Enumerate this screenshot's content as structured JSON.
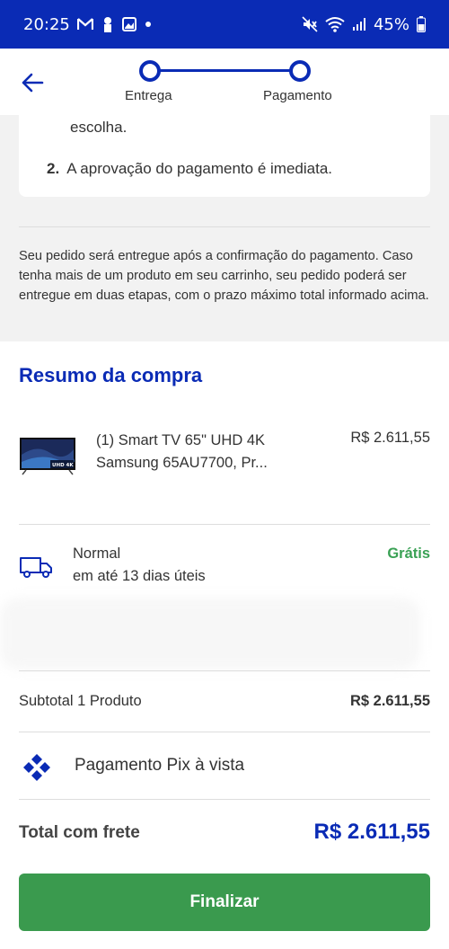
{
  "status_bar": {
    "time": "20:25",
    "battery": "45%",
    "icons": [
      "gmail-icon",
      "person-pin-icon",
      "gallery-icon",
      "dot-icon",
      "mute-icon",
      "wifi-icon",
      "signal-icon",
      "battery-icon"
    ]
  },
  "header": {
    "steps": [
      {
        "label": "Entrega"
      },
      {
        "label": "Pagamento"
      }
    ],
    "accent": "#0a2bb5"
  },
  "payment_steps": {
    "step1_tail": "escolha.",
    "step2_number": "2.",
    "step2_text": "A aprovação do pagamento é imediata."
  },
  "notice": "Seu pedido será entregue após a confirmação do pagamento. Caso tenha mais de um produto em seu carrinho, seu pedido poderá ser entregue em duas etapas, com o prazo máximo total informado acima.",
  "summary": {
    "title": "Resumo da compra",
    "product": {
      "name": "(1) Smart TV 65\" UHD 4K Samsung 65AU7700, Pr...",
      "price": "R$ 2.611,55",
      "thumb_badge": "UHD 4K"
    },
    "shipping": {
      "type": "Normal",
      "time": "em até 13 dias úteis",
      "price": "Grátis",
      "price_color": "#3aa155"
    },
    "subtotal_label": "Subtotal 1 Produto",
    "subtotal_value": "R$ 2.611,55",
    "payment_method": "Pagamento Pix à vista",
    "total_label": "Total com frete",
    "total_value": "R$ 2.611,55"
  },
  "actions": {
    "finalize_label": "Finalizar",
    "finalize_color": "#3a9a4e"
  }
}
